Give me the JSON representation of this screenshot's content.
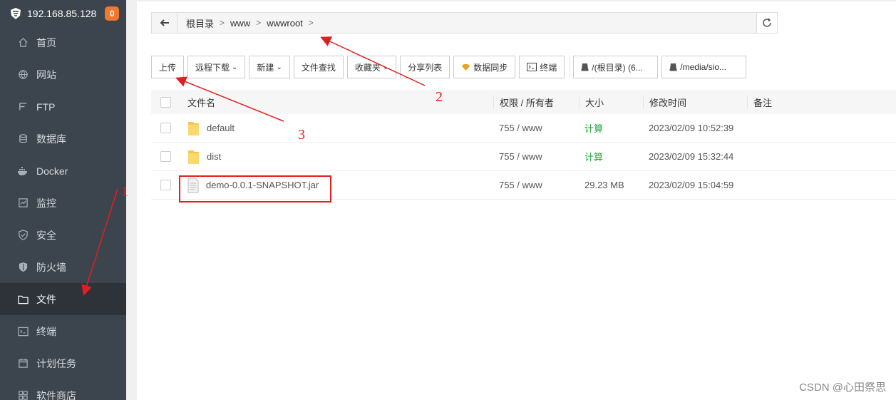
{
  "sidebar": {
    "host": "192.168.85.128",
    "badge": "0",
    "items": [
      {
        "label": "首页",
        "icon": "home-icon"
      },
      {
        "label": "网站",
        "icon": "globe-icon"
      },
      {
        "label": "FTP",
        "icon": "ftp-icon"
      },
      {
        "label": "数据库",
        "icon": "database-icon"
      },
      {
        "label": "Docker",
        "icon": "docker-icon"
      },
      {
        "label": "监控",
        "icon": "monitor-icon"
      },
      {
        "label": "安全",
        "icon": "shield-icon"
      },
      {
        "label": "防火墙",
        "icon": "firewall-icon"
      },
      {
        "label": "文件",
        "icon": "folder-icon"
      },
      {
        "label": "终端",
        "icon": "terminal-icon"
      },
      {
        "label": "计划任务",
        "icon": "calendar-icon"
      },
      {
        "label": "软件商店",
        "icon": "store-icon"
      }
    ]
  },
  "breadcrumb": [
    "根目录",
    "www",
    "wwwroot"
  ],
  "toolbar": {
    "upload": "上传",
    "remote_download": "远程下载",
    "new": "新建",
    "file_search": "文件查找",
    "favorites": "收藏夹",
    "share_list": "分享列表",
    "data_sync": "数据同步",
    "terminal": "终端",
    "disk_root": "/(根目录) (6...",
    "disk_media": "/media/sio..."
  },
  "table": {
    "headers": {
      "name": "文件名",
      "perm": "权限 / 所有者",
      "size": "大小",
      "time": "修改时间",
      "note": "备注"
    },
    "rows": [
      {
        "name": "default",
        "type": "folder",
        "perm": "755 / www",
        "size": "计算",
        "time": "2023/02/09 10:52:39"
      },
      {
        "name": "dist",
        "type": "folder",
        "perm": "755 / www",
        "size": "计算",
        "time": "2023/02/09 15:32:44"
      },
      {
        "name": "demo-0.0.1-SNAPSHOT.jar",
        "type": "file",
        "perm": "755 / www",
        "size": "29.23 MB",
        "time": "2023/02/09 15:04:59"
      }
    ]
  },
  "annotations": {
    "n1": "1",
    "n2": "2",
    "n3": "3",
    "color": "#e02020"
  },
  "watermark": "CSDN @心田祭思"
}
